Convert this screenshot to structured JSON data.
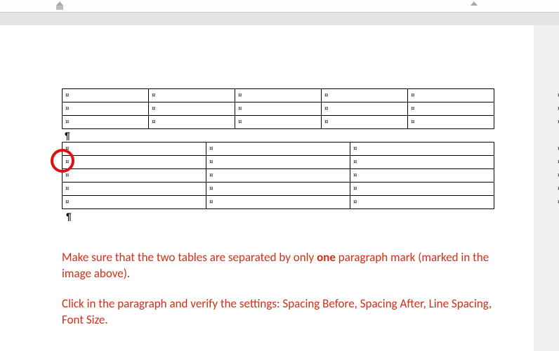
{
  "ruler": {},
  "cell_mark": "¤",
  "para_mark": "¶",
  "table1": {
    "rows": 3,
    "cols": 5
  },
  "table2": {
    "rows": 5,
    "cols": 3
  },
  "instructions": {
    "p1_a": "Make sure that the two tables are separated by only ",
    "p1_bold": "one",
    "p1_b": " paragraph mark (marked in the image above).",
    "p2": "Click in the paragraph and verify the settings: Spacing Before, Spacing After, Line Spacing, Font Size."
  }
}
